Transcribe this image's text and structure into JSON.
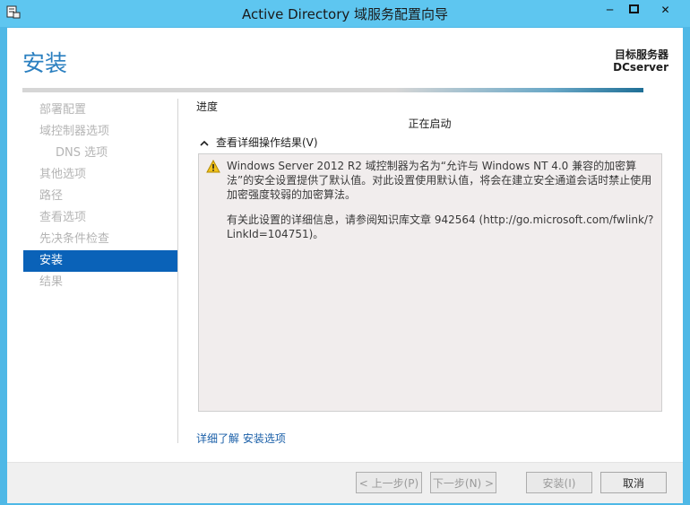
{
  "window": {
    "title": "Active Directory 域服务配置向导",
    "buttons": {
      "minimize": "─",
      "close": "✕"
    }
  },
  "header": {
    "page_title": "安装",
    "target_label": "目标服务器",
    "target_name": "DCserver"
  },
  "nav": {
    "items": [
      {
        "label": "部署配置",
        "state": "disabled"
      },
      {
        "label": "域控制器选项",
        "state": "disabled"
      },
      {
        "label": "DNS 选项",
        "state": "disabled",
        "sub": true
      },
      {
        "label": "其他选项",
        "state": "disabled"
      },
      {
        "label": "路径",
        "state": "disabled"
      },
      {
        "label": "查看选项",
        "state": "disabled"
      },
      {
        "label": "先决条件检查",
        "state": "disabled"
      },
      {
        "label": "安装",
        "state": "active"
      },
      {
        "label": "结果",
        "state": "disabled"
      }
    ]
  },
  "main": {
    "progress_label": "进度",
    "status_text": "正在启动",
    "details_toggle": "查看详细操作结果(V)",
    "messages": [
      "Windows Server 2012 R2 域控制器为名为“允许与 Windows NT 4.0 兼容的加密算法”的安全设置提供了默认值。对此设置使用默认值，将会在建立安全通道会话时禁止使用加密强度较弱的加密算法。",
      "有关此设置的详细信息，请参阅知识库文章 942564 (http://go.microsoft.com/fwlink/?LinkId=104751)。"
    ],
    "more_link": "详细了解 安装选项"
  },
  "footer": {
    "prev": "< 上一步(P)",
    "next": "下一步(N) >",
    "install": "安装(I)",
    "cancel": "取消"
  },
  "colors": {
    "titlebar": "#5ec6f0",
    "accent": "#2a7fc0",
    "nav_active": "#0a62b8",
    "link": "#1a5fa8"
  }
}
